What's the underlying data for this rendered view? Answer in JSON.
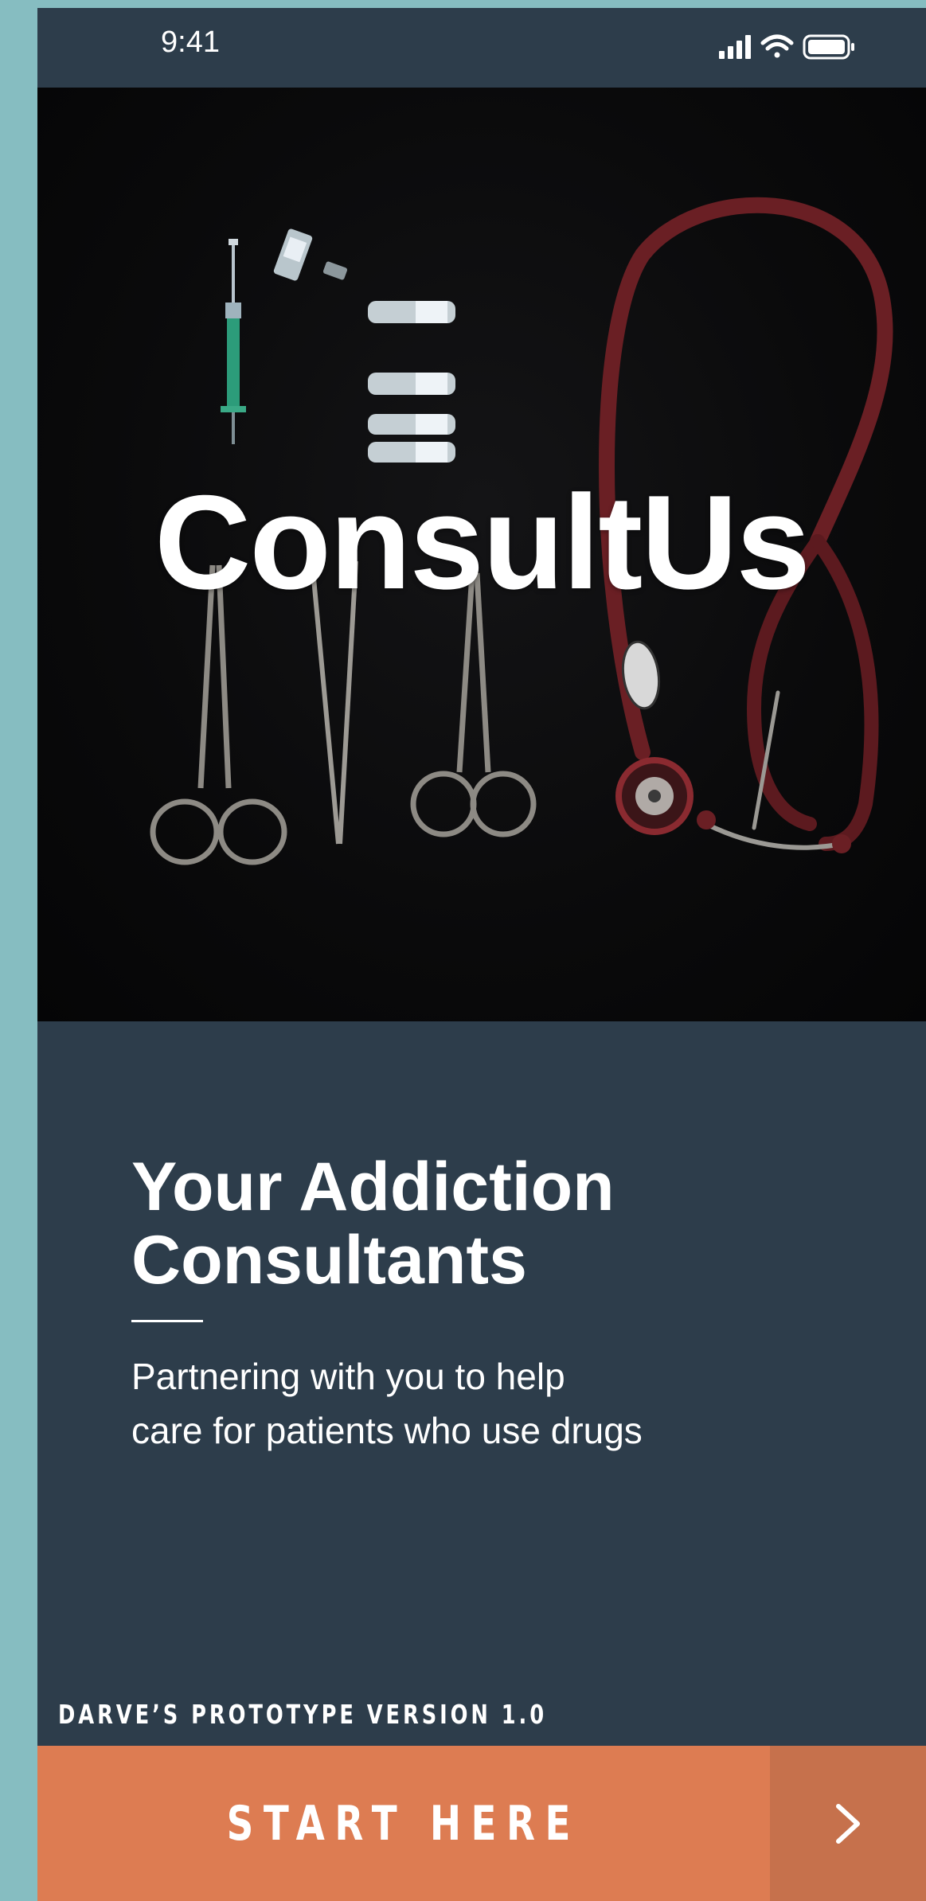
{
  "status_bar": {
    "time": "9:41",
    "icons": [
      "cellular-signal-icon",
      "wifi-icon",
      "battery-icon"
    ]
  },
  "hero": {
    "brand": "ConsultUs",
    "image_subject": "medical-instruments-photo"
  },
  "intro": {
    "headline": "Your Addiction Consultants",
    "tagline": "Partnering  with you to help\ncare for patients who use drugs"
  },
  "footer": {
    "version": "DARVE’S PROTOTYPE VERSION 1.0",
    "cta_label": "START HERE",
    "cta_icon": "chevron-right-icon"
  },
  "colors": {
    "page_background": "#86bdc1",
    "screen_background": "#2d3d4b",
    "cta_primary": "#dd7c52",
    "cta_secondary": "#c6714c",
    "text": "#ffffff"
  }
}
